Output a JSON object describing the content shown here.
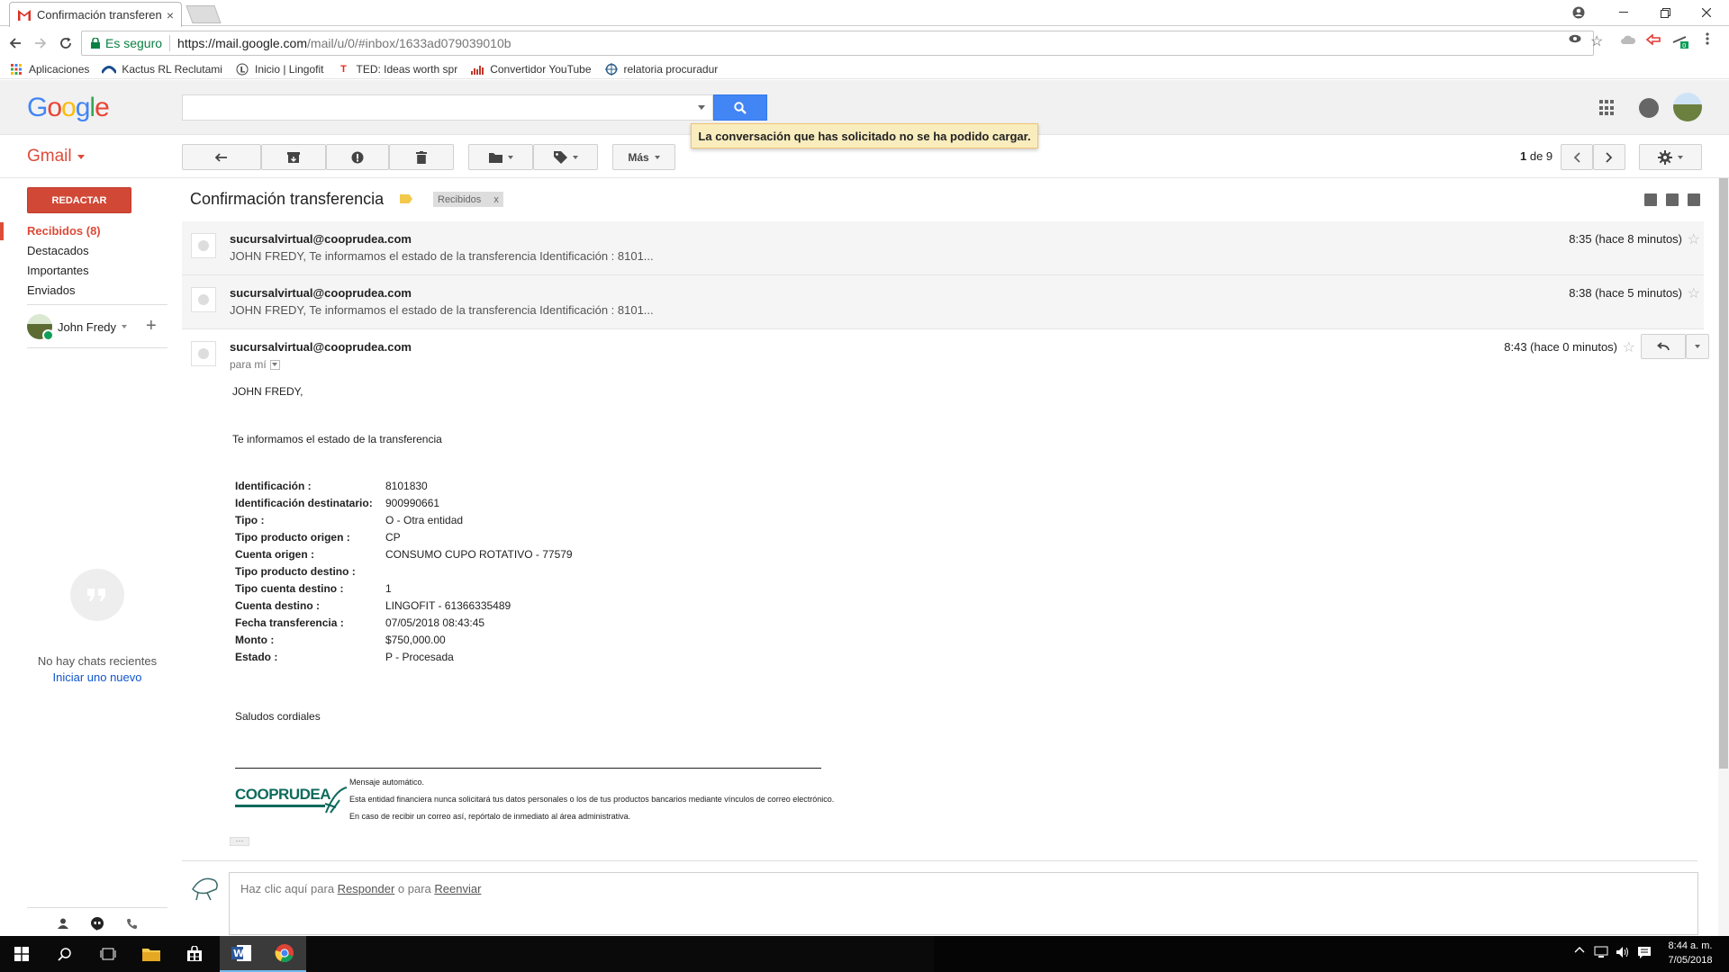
{
  "browser": {
    "tab_title": "Confirmación transferenc",
    "tab_close": "×",
    "secure_label": "Es seguro",
    "url_main": "https://mail.google.com",
    "url_rest": "/mail/u/0/#inbox/1633ad079039010b",
    "bookmarks": [
      {
        "label": "Aplicaciones",
        "icon": "apps-grid-icon"
      },
      {
        "label": "Kactus RL Reclutami",
        "icon": "kactus-icon"
      },
      {
        "label": "Inicio | Lingofit",
        "icon": "lingofit-icon"
      },
      {
        "label": "TED: Ideas worth spr",
        "icon": "ted-icon"
      },
      {
        "label": "Convertidor YouTube",
        "icon": "converter-icon"
      },
      {
        "label": "relatoria procuradur",
        "icon": "relatoria-icon"
      }
    ]
  },
  "gmail": {
    "logo": "Google",
    "app_label": "Gmail",
    "toast": "La conversación que has solicitado no se ha podido cargar.",
    "more_label": "Más",
    "pager_prefix": "1",
    "pager_suffix": " de 9",
    "compose_label": "REDACTAR",
    "nav": [
      {
        "label": "Recibidos (8)"
      },
      {
        "label": "Destacados"
      },
      {
        "label": "Importantes"
      },
      {
        "label": "Enviados"
      }
    ],
    "hangouts_user": "John Fredy",
    "no_chats": "No hay chats recientes",
    "start_chat": "Iniciar uno nuevo"
  },
  "conversation": {
    "title": "Confirmación transferencia",
    "label_chip": "Recibidos",
    "label_chip_close": "x",
    "messages": [
      {
        "from": "sucursalvirtual@cooprudea.com",
        "snippet": "JOHN FREDY, Te informamos el estado de la transferencia Identificación : 8101...",
        "time": "8:35 (hace 8 minutos)"
      },
      {
        "from": "sucursalvirtual@cooprudea.com",
        "snippet": "JOHN FREDY, Te informamos el estado de la transferencia Identificación : 8101...",
        "time": "8:38 (hace 5 minutos)"
      }
    ],
    "open_message": {
      "from": "sucursalvirtual@cooprudea.com",
      "to": "para mí",
      "time": "8:43 (hace 0 minutos)",
      "greeting": "JOHN FREDY,",
      "intro": "Te informamos el estado de la transferencia",
      "fields": [
        {
          "label": "Identificación :",
          "value": "8101830"
        },
        {
          "label": "Identificación destinatario:",
          "value": "900990661"
        },
        {
          "label": "Tipo :",
          "value": "O - Otra entidad"
        },
        {
          "label": "Tipo producto origen :",
          "value": "CP"
        },
        {
          "label": "Cuenta origen :",
          "value": "CONSUMO CUPO ROTATIVO - 77579"
        },
        {
          "label": "Tipo producto destino :",
          "value": ""
        },
        {
          "label": "Tipo cuenta destino :",
          "value": "1"
        },
        {
          "label": "Cuenta destino :",
          "value": "LINGOFIT - 61366335489"
        },
        {
          "label": "Fecha transferencia :",
          "value": "07/05/2018 08:43:45"
        },
        {
          "label": "Monto :",
          "value": "$750,000.00"
        },
        {
          "label": "Estado :",
          "value": "P - Procesada"
        }
      ],
      "closing": "Saludos cordiales",
      "logo_text": "COOPRUDEA",
      "sig_lines": [
        "Mensaje automático.",
        "Esta entidad financiera nunca solicitará tus datos personales o los de tus productos bancarios mediante vínculos de correo electrónico.",
        "En caso de recibir un correo así, repórtalo de inmediato al área administrativa."
      ],
      "ellipsis": "···"
    },
    "reply": {
      "prefix": "Haz clic aquí para ",
      "reply_link": "Responder",
      "middle": " o para ",
      "forward_link": "Reenviar"
    }
  },
  "taskbar": {
    "time": "8:44 a. m.",
    "date": "7/05/2018"
  }
}
